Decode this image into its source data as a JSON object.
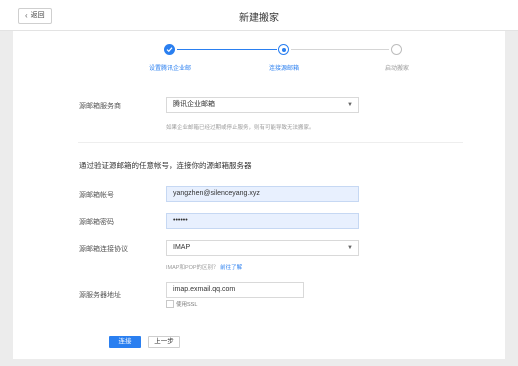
{
  "header": {
    "back_label": "返回",
    "title": "新建搬家"
  },
  "steps": [
    {
      "label": "设置腾讯企业邮",
      "state": "done"
    },
    {
      "label": "连接源邮箱",
      "state": "current"
    },
    {
      "label": "启动搬家",
      "state": "pending"
    }
  ],
  "form": {
    "provider_label": "源邮箱服务商",
    "provider_value": "腾讯企业邮箱",
    "provider_hint": "如果企业邮箱已经过期或停止服务，则有可能导致无法搬家。",
    "section_title": "通过验证源邮箱的任意帐号，连接你的源邮箱服务器",
    "account_label": "源邮箱帐号",
    "account_value": "yangzhen@silenceyang.xyz",
    "password_label": "源邮箱密码",
    "password_value": "••••••",
    "protocol_label": "源邮箱连接协议",
    "protocol_value": "IMAP",
    "protocol_hint": "IMAP和POP的区别？",
    "protocol_link": "前往了解",
    "server_label": "源服务器地址",
    "server_value": "imap.exmail.qq.com",
    "ssl_label": "使用SSL",
    "ssl_checked": false
  },
  "actions": {
    "connect_label": "连接",
    "prev_label": "上一步"
  },
  "colors": {
    "accent": "#2a7ff0",
    "autofill_bg": "#e8f0fe"
  }
}
